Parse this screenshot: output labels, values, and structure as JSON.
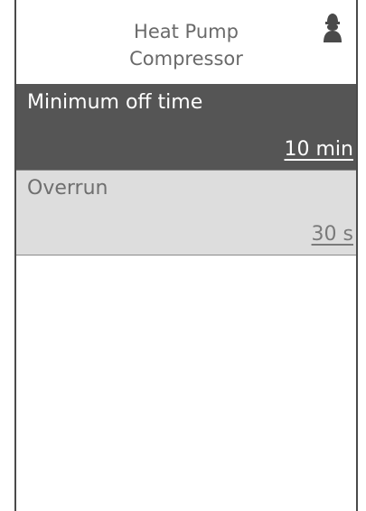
{
  "header": {
    "title_line1": "Heat Pump",
    "title_line2": "Compressor",
    "user_icon": "user-profile-icon"
  },
  "settings": [
    {
      "label": "Minimum off time",
      "value": "10 min",
      "selected": true
    },
    {
      "label": "Overrun",
      "value": "30 s",
      "selected": false
    }
  ],
  "colors": {
    "selected_background": "#555555",
    "normal_background": "#dddddd",
    "frame_border": "#4a4a4a",
    "title_text": "#6a6a6a"
  }
}
